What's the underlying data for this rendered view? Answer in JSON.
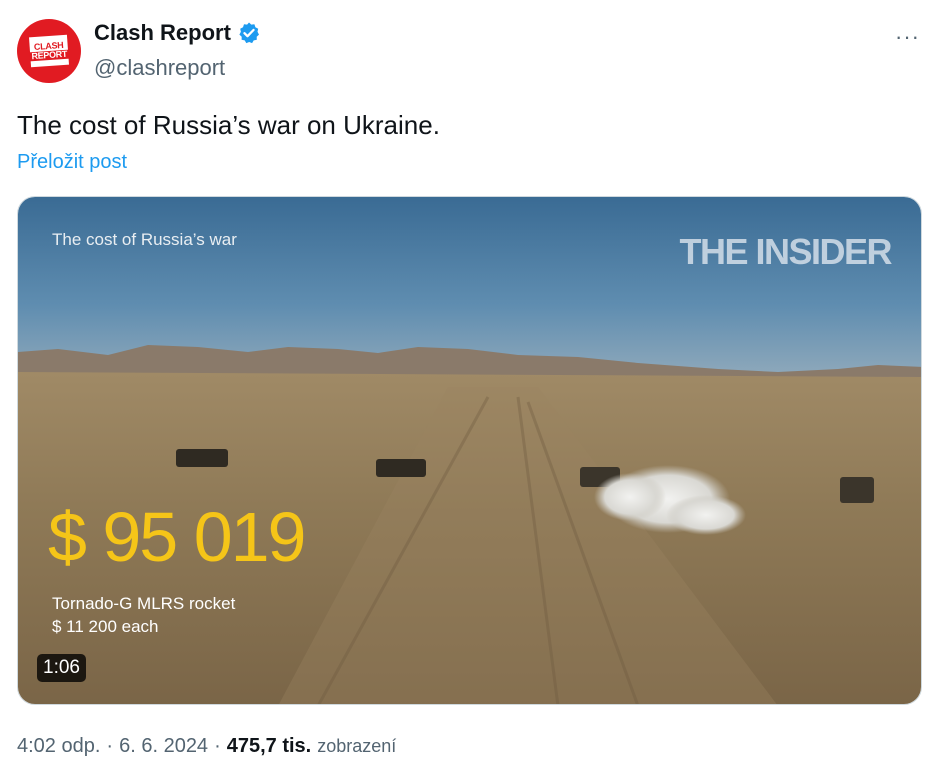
{
  "author": {
    "display_name": "Clash Report",
    "handle": "@clashreport",
    "avatar_text_top": "CLASH",
    "avatar_text_bottom": "REPORT",
    "verified_color": "#1d9bf0"
  },
  "more_label": "···",
  "tweet": {
    "text": "The cost of Russia’s war on Ukraine.",
    "translate_label": "Přeložit post"
  },
  "media": {
    "overlay_title": "The cost of Russia’s war",
    "brand": "THE INSIDER",
    "cost": "$ 95 019",
    "weapon": "Tornado-G MLRS rocket",
    "unit_price": "$ 11 200 each",
    "duration": "1:06",
    "cost_color": "#f5c518"
  },
  "meta": {
    "time": "4:02 odp.",
    "sep1": "·",
    "date": "6. 6. 2024",
    "sep2": "·",
    "views": "475,7 tis.",
    "views_label": "zobrazení"
  }
}
